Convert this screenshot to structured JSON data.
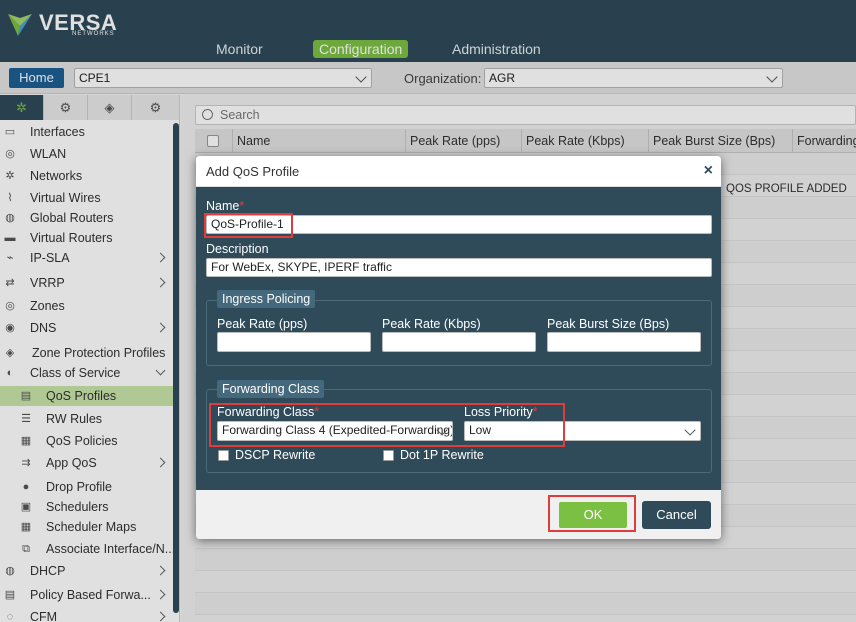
{
  "brand": {
    "name": "VERSA",
    "sub": "NETWORKS"
  },
  "nav": {
    "items": [
      "Monitor",
      "Configuration",
      "Administration"
    ],
    "active": "Configuration"
  },
  "subbar": {
    "home_label": "Home",
    "device_value": "CPE1",
    "org_label": "Organization:",
    "org_value": "AGR"
  },
  "sidebar": {
    "tabs": [
      "network-icon",
      "gear-icon",
      "box-icon",
      "gear-lock-icon"
    ],
    "items": [
      {
        "label": "Interfaces",
        "icon": "interfaces-icon"
      },
      {
        "label": "WLAN",
        "icon": "wifi-icon"
      },
      {
        "label": "Networks",
        "icon": "network-icon"
      },
      {
        "label": "Virtual Wires",
        "icon": "wire-icon"
      },
      {
        "label": "Global Routers",
        "icon": "router-icon"
      },
      {
        "label": "Virtual Routers",
        "icon": "router-icon"
      },
      {
        "label": "IP-SLA",
        "icon": "sla-icon"
      },
      {
        "label": "VRRP",
        "icon": "vrrp-icon"
      },
      {
        "label": "Zones",
        "icon": "zone-icon"
      },
      {
        "label": "DNS",
        "icon": "dns-icon"
      },
      {
        "label": "Zone Protection Profiles",
        "icon": "shield-icon"
      },
      {
        "label": "Class of Service",
        "icon": "cos-icon"
      },
      {
        "label": "QoS Profiles",
        "icon": "qos-icon"
      },
      {
        "label": "RW Rules",
        "icon": "rules-icon"
      },
      {
        "label": "QoS Policies",
        "icon": "policy-icon"
      },
      {
        "label": "App QoS",
        "icon": "app-icon"
      },
      {
        "label": "Drop Profile",
        "icon": "drop-icon"
      },
      {
        "label": "Schedulers",
        "icon": "scheduler-icon"
      },
      {
        "label": "Scheduler Maps",
        "icon": "map-icon"
      },
      {
        "label": "Associate Interface/N...",
        "icon": "associate-icon"
      },
      {
        "label": "DHCP",
        "icon": "dhcp-icon"
      },
      {
        "label": "Policy Based Forwa...",
        "icon": "forward-icon"
      },
      {
        "label": "CFM",
        "icon": "cfm-icon"
      }
    ]
  },
  "table": {
    "search_placeholder": "Search",
    "columns": [
      "Name",
      "Peak Rate (pps)",
      "Peak Rate (Kbps)",
      "Peak Burst Size (Bps)",
      "Forwarding"
    ],
    "status_text": "QOS PROFILE ADDED"
  },
  "modal": {
    "title": "Add QoS Profile",
    "close": "×",
    "name_label": "Name",
    "name_value": "QoS-Profile-1",
    "description_label": "Description",
    "description_value": "For WebEx, SKYPE, IPERF traffic",
    "ingress": {
      "legend": "Ingress Policing",
      "peak_rate_pps": "Peak Rate (pps)",
      "peak_rate_kbps": "Peak Rate (Kbps)",
      "peak_burst": "Peak Burst Size (Bps)"
    },
    "forwarding": {
      "legend": "Forwarding Class",
      "class_label": "Forwarding Class",
      "class_value": "Forwarding Class 4 (Expedited-Forwarding)",
      "loss_label": "Loss Priority",
      "loss_value": "Low",
      "dscp_label": "DSCP Rewrite",
      "dot1p_label": "Dot 1P Rewrite"
    },
    "ok_label": "OK",
    "cancel_label": "Cancel"
  },
  "colors": {
    "header": "#2f4b5a",
    "accent": "#7bc043",
    "home": "#1d5f95",
    "highlight": "#e03c3c"
  }
}
